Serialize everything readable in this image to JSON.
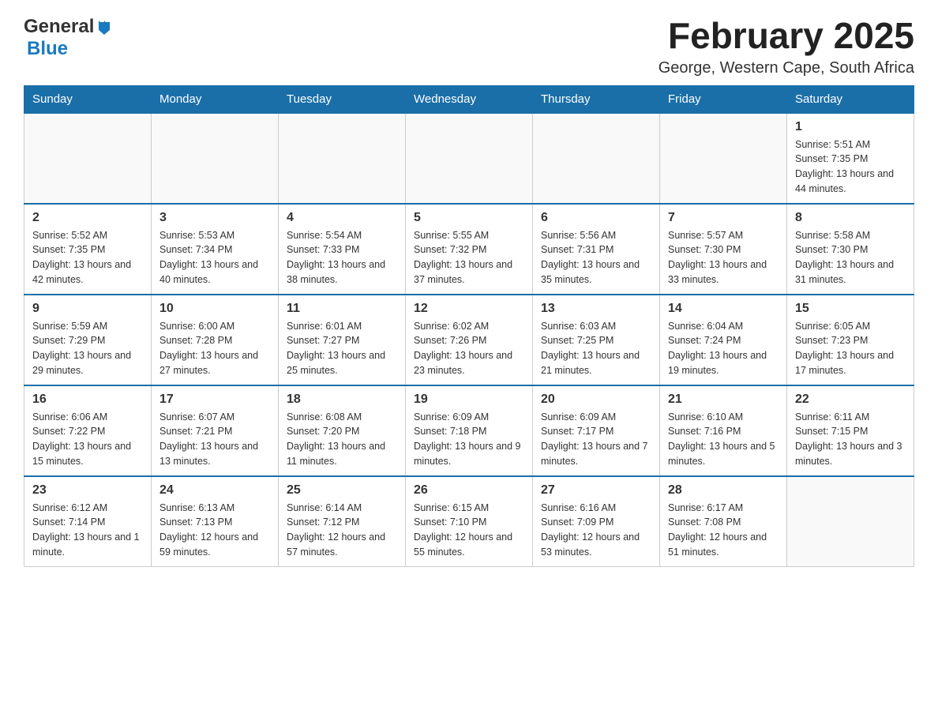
{
  "header": {
    "logo": {
      "general": "General",
      "blue": "Blue",
      "arrow_unicode": "▶"
    },
    "title": "February 2025",
    "location": "George, Western Cape, South Africa"
  },
  "calendar": {
    "days_of_week": [
      "Sunday",
      "Monday",
      "Tuesday",
      "Wednesday",
      "Thursday",
      "Friday",
      "Saturday"
    ],
    "weeks": [
      [
        {
          "day": "",
          "info": ""
        },
        {
          "day": "",
          "info": ""
        },
        {
          "day": "",
          "info": ""
        },
        {
          "day": "",
          "info": ""
        },
        {
          "day": "",
          "info": ""
        },
        {
          "day": "",
          "info": ""
        },
        {
          "day": "1",
          "info": "Sunrise: 5:51 AM\nSunset: 7:35 PM\nDaylight: 13 hours and 44 minutes."
        }
      ],
      [
        {
          "day": "2",
          "info": "Sunrise: 5:52 AM\nSunset: 7:35 PM\nDaylight: 13 hours and 42 minutes."
        },
        {
          "day": "3",
          "info": "Sunrise: 5:53 AM\nSunset: 7:34 PM\nDaylight: 13 hours and 40 minutes."
        },
        {
          "day": "4",
          "info": "Sunrise: 5:54 AM\nSunset: 7:33 PM\nDaylight: 13 hours and 38 minutes."
        },
        {
          "day": "5",
          "info": "Sunrise: 5:55 AM\nSunset: 7:32 PM\nDaylight: 13 hours and 37 minutes."
        },
        {
          "day": "6",
          "info": "Sunrise: 5:56 AM\nSunset: 7:31 PM\nDaylight: 13 hours and 35 minutes."
        },
        {
          "day": "7",
          "info": "Sunrise: 5:57 AM\nSunset: 7:30 PM\nDaylight: 13 hours and 33 minutes."
        },
        {
          "day": "8",
          "info": "Sunrise: 5:58 AM\nSunset: 7:30 PM\nDaylight: 13 hours and 31 minutes."
        }
      ],
      [
        {
          "day": "9",
          "info": "Sunrise: 5:59 AM\nSunset: 7:29 PM\nDaylight: 13 hours and 29 minutes."
        },
        {
          "day": "10",
          "info": "Sunrise: 6:00 AM\nSunset: 7:28 PM\nDaylight: 13 hours and 27 minutes."
        },
        {
          "day": "11",
          "info": "Sunrise: 6:01 AM\nSunset: 7:27 PM\nDaylight: 13 hours and 25 minutes."
        },
        {
          "day": "12",
          "info": "Sunrise: 6:02 AM\nSunset: 7:26 PM\nDaylight: 13 hours and 23 minutes."
        },
        {
          "day": "13",
          "info": "Sunrise: 6:03 AM\nSunset: 7:25 PM\nDaylight: 13 hours and 21 minutes."
        },
        {
          "day": "14",
          "info": "Sunrise: 6:04 AM\nSunset: 7:24 PM\nDaylight: 13 hours and 19 minutes."
        },
        {
          "day": "15",
          "info": "Sunrise: 6:05 AM\nSunset: 7:23 PM\nDaylight: 13 hours and 17 minutes."
        }
      ],
      [
        {
          "day": "16",
          "info": "Sunrise: 6:06 AM\nSunset: 7:22 PM\nDaylight: 13 hours and 15 minutes."
        },
        {
          "day": "17",
          "info": "Sunrise: 6:07 AM\nSunset: 7:21 PM\nDaylight: 13 hours and 13 minutes."
        },
        {
          "day": "18",
          "info": "Sunrise: 6:08 AM\nSunset: 7:20 PM\nDaylight: 13 hours and 11 minutes."
        },
        {
          "day": "19",
          "info": "Sunrise: 6:09 AM\nSunset: 7:18 PM\nDaylight: 13 hours and 9 minutes."
        },
        {
          "day": "20",
          "info": "Sunrise: 6:09 AM\nSunset: 7:17 PM\nDaylight: 13 hours and 7 minutes."
        },
        {
          "day": "21",
          "info": "Sunrise: 6:10 AM\nSunset: 7:16 PM\nDaylight: 13 hours and 5 minutes."
        },
        {
          "day": "22",
          "info": "Sunrise: 6:11 AM\nSunset: 7:15 PM\nDaylight: 13 hours and 3 minutes."
        }
      ],
      [
        {
          "day": "23",
          "info": "Sunrise: 6:12 AM\nSunset: 7:14 PM\nDaylight: 13 hours and 1 minute."
        },
        {
          "day": "24",
          "info": "Sunrise: 6:13 AM\nSunset: 7:13 PM\nDaylight: 12 hours and 59 minutes."
        },
        {
          "day": "25",
          "info": "Sunrise: 6:14 AM\nSunset: 7:12 PM\nDaylight: 12 hours and 57 minutes."
        },
        {
          "day": "26",
          "info": "Sunrise: 6:15 AM\nSunset: 7:10 PM\nDaylight: 12 hours and 55 minutes."
        },
        {
          "day": "27",
          "info": "Sunrise: 6:16 AM\nSunset: 7:09 PM\nDaylight: 12 hours and 53 minutes."
        },
        {
          "day": "28",
          "info": "Sunrise: 6:17 AM\nSunset: 7:08 PM\nDaylight: 12 hours and 51 minutes."
        },
        {
          "day": "",
          "info": ""
        }
      ]
    ]
  }
}
